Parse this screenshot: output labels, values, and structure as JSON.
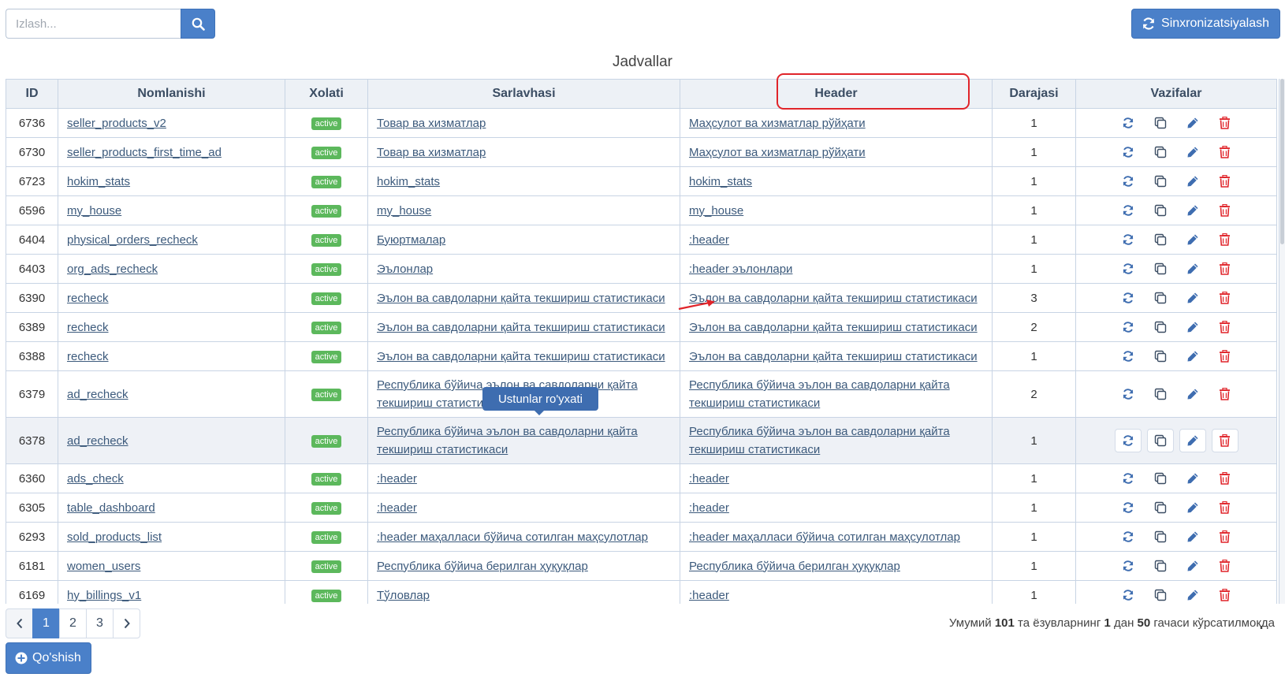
{
  "search": {
    "placeholder": "Izlash..."
  },
  "toolbar": {
    "sync_label": "Sinxronizatsiyalash",
    "add_label": "Qo'shish"
  },
  "table": {
    "title": "Jadvallar",
    "columns": [
      "ID",
      "Nomlanishi",
      "Xolati",
      "Sarlavhasi",
      "Header",
      "Darajasi",
      "Vazifalar"
    ],
    "rows": [
      {
        "id": "6736",
        "name": "seller_products_v2",
        "status": "active",
        "title": "Товар ва хизматлар",
        "header": "Маҳсулот ва хизматлар рўйҳати",
        "level": "1"
      },
      {
        "id": "6730",
        "name": "seller_products_first_time_ad",
        "status": "active",
        "title": "Товар ва хизматлар",
        "header": "Маҳсулот ва хизматлар рўйҳати",
        "level": "1"
      },
      {
        "id": "6723",
        "name": "hokim_stats",
        "status": "active",
        "title": "hokim_stats",
        "header": "hokim_stats",
        "level": "1"
      },
      {
        "id": "6596",
        "name": "my_house",
        "status": "active",
        "title": "my_house",
        "header": "my_house",
        "level": "1"
      },
      {
        "id": "6404",
        "name": "physical_orders_recheck",
        "status": "active",
        "title": "Буюртмалар",
        "header": ":header",
        "level": "1"
      },
      {
        "id": "6403",
        "name": "org_ads_recheck",
        "status": "active",
        "title": "Эълонлар",
        "header": ":header эълонлари",
        "level": "1"
      },
      {
        "id": "6390",
        "name": "recheck",
        "status": "active",
        "title": "Эълон ва савдоларни қайта текшириш статистикаси",
        "header": "Эълон ва савдоларни қайта текшириш статистикаси",
        "level": "3"
      },
      {
        "id": "6389",
        "name": "recheck",
        "status": "active",
        "title": "Эълон ва савдоларни қайта текшириш статистикаси",
        "header": "Эълон ва савдоларни қайта текшириш статистикаси",
        "level": "2"
      },
      {
        "id": "6388",
        "name": "recheck",
        "status": "active",
        "title": "Эълон ва савдоларни қайта текшириш статистикаси",
        "header": "Эълон ва савдоларни қайта текшириш статистикаси",
        "level": "1"
      },
      {
        "id": "6379",
        "name": "ad_recheck",
        "status": "active",
        "title": "Республика бўйича эълон ва савдоларни қайта текшириш статистикаси",
        "header": "Республика бўйича эълон ва савдоларни қайта текшириш статистикаси",
        "level": "2"
      },
      {
        "id": "6378",
        "name": "ad_recheck",
        "status": "active",
        "title": "Республика бўйича эълон ва савдоларни қайта текшириш статистикаси",
        "header": "Республика бўйича эълон ва савдоларни қайта текшириш статистикаси",
        "level": "1"
      },
      {
        "id": "6360",
        "name": "ads_check",
        "status": "active",
        "title": ":header",
        "header": ":header",
        "level": "1"
      },
      {
        "id": "6305",
        "name": "table_dashboard",
        "status": "active",
        "title": ":header",
        "header": ":header",
        "level": "1"
      },
      {
        "id": "6293",
        "name": "sold_products_list",
        "status": "active",
        "title": ":header маҳалласи бўйича сотилган маҳсулотлар",
        "header": ":header маҳалласи бўйича сотилган маҳсулотлар",
        "level": "1"
      },
      {
        "id": "6181",
        "name": "women_users",
        "status": "active",
        "title": "Республика бўйича берилган ҳуқуқлар",
        "header": "Республика бўйича берилган ҳуқуқлар",
        "level": "1"
      },
      {
        "id": "6169",
        "name": "hy_billings_v1",
        "status": "active",
        "title": "Тўловлар",
        "header": ":header",
        "level": "1"
      }
    ]
  },
  "tooltip": {
    "text": "Ustunlar ro'yxati"
  },
  "pagination": {
    "pages": [
      "1",
      "2",
      "3"
    ],
    "active": "1",
    "prev_icon": "chevron-left-icon",
    "next_icon": "chevron-right-icon"
  },
  "summary": {
    "prefix": "Умумий",
    "total": "101",
    "middle": "та ёзувларнинг",
    "from": "1",
    "to_word": "дан",
    "to": "50",
    "suffix": "гачаси кўрсатилмоқда"
  },
  "colors": {
    "primary": "#4a80c9",
    "badge_active": "#5cb85c",
    "danger": "#e0242a",
    "header_bg": "#edf1f6"
  }
}
